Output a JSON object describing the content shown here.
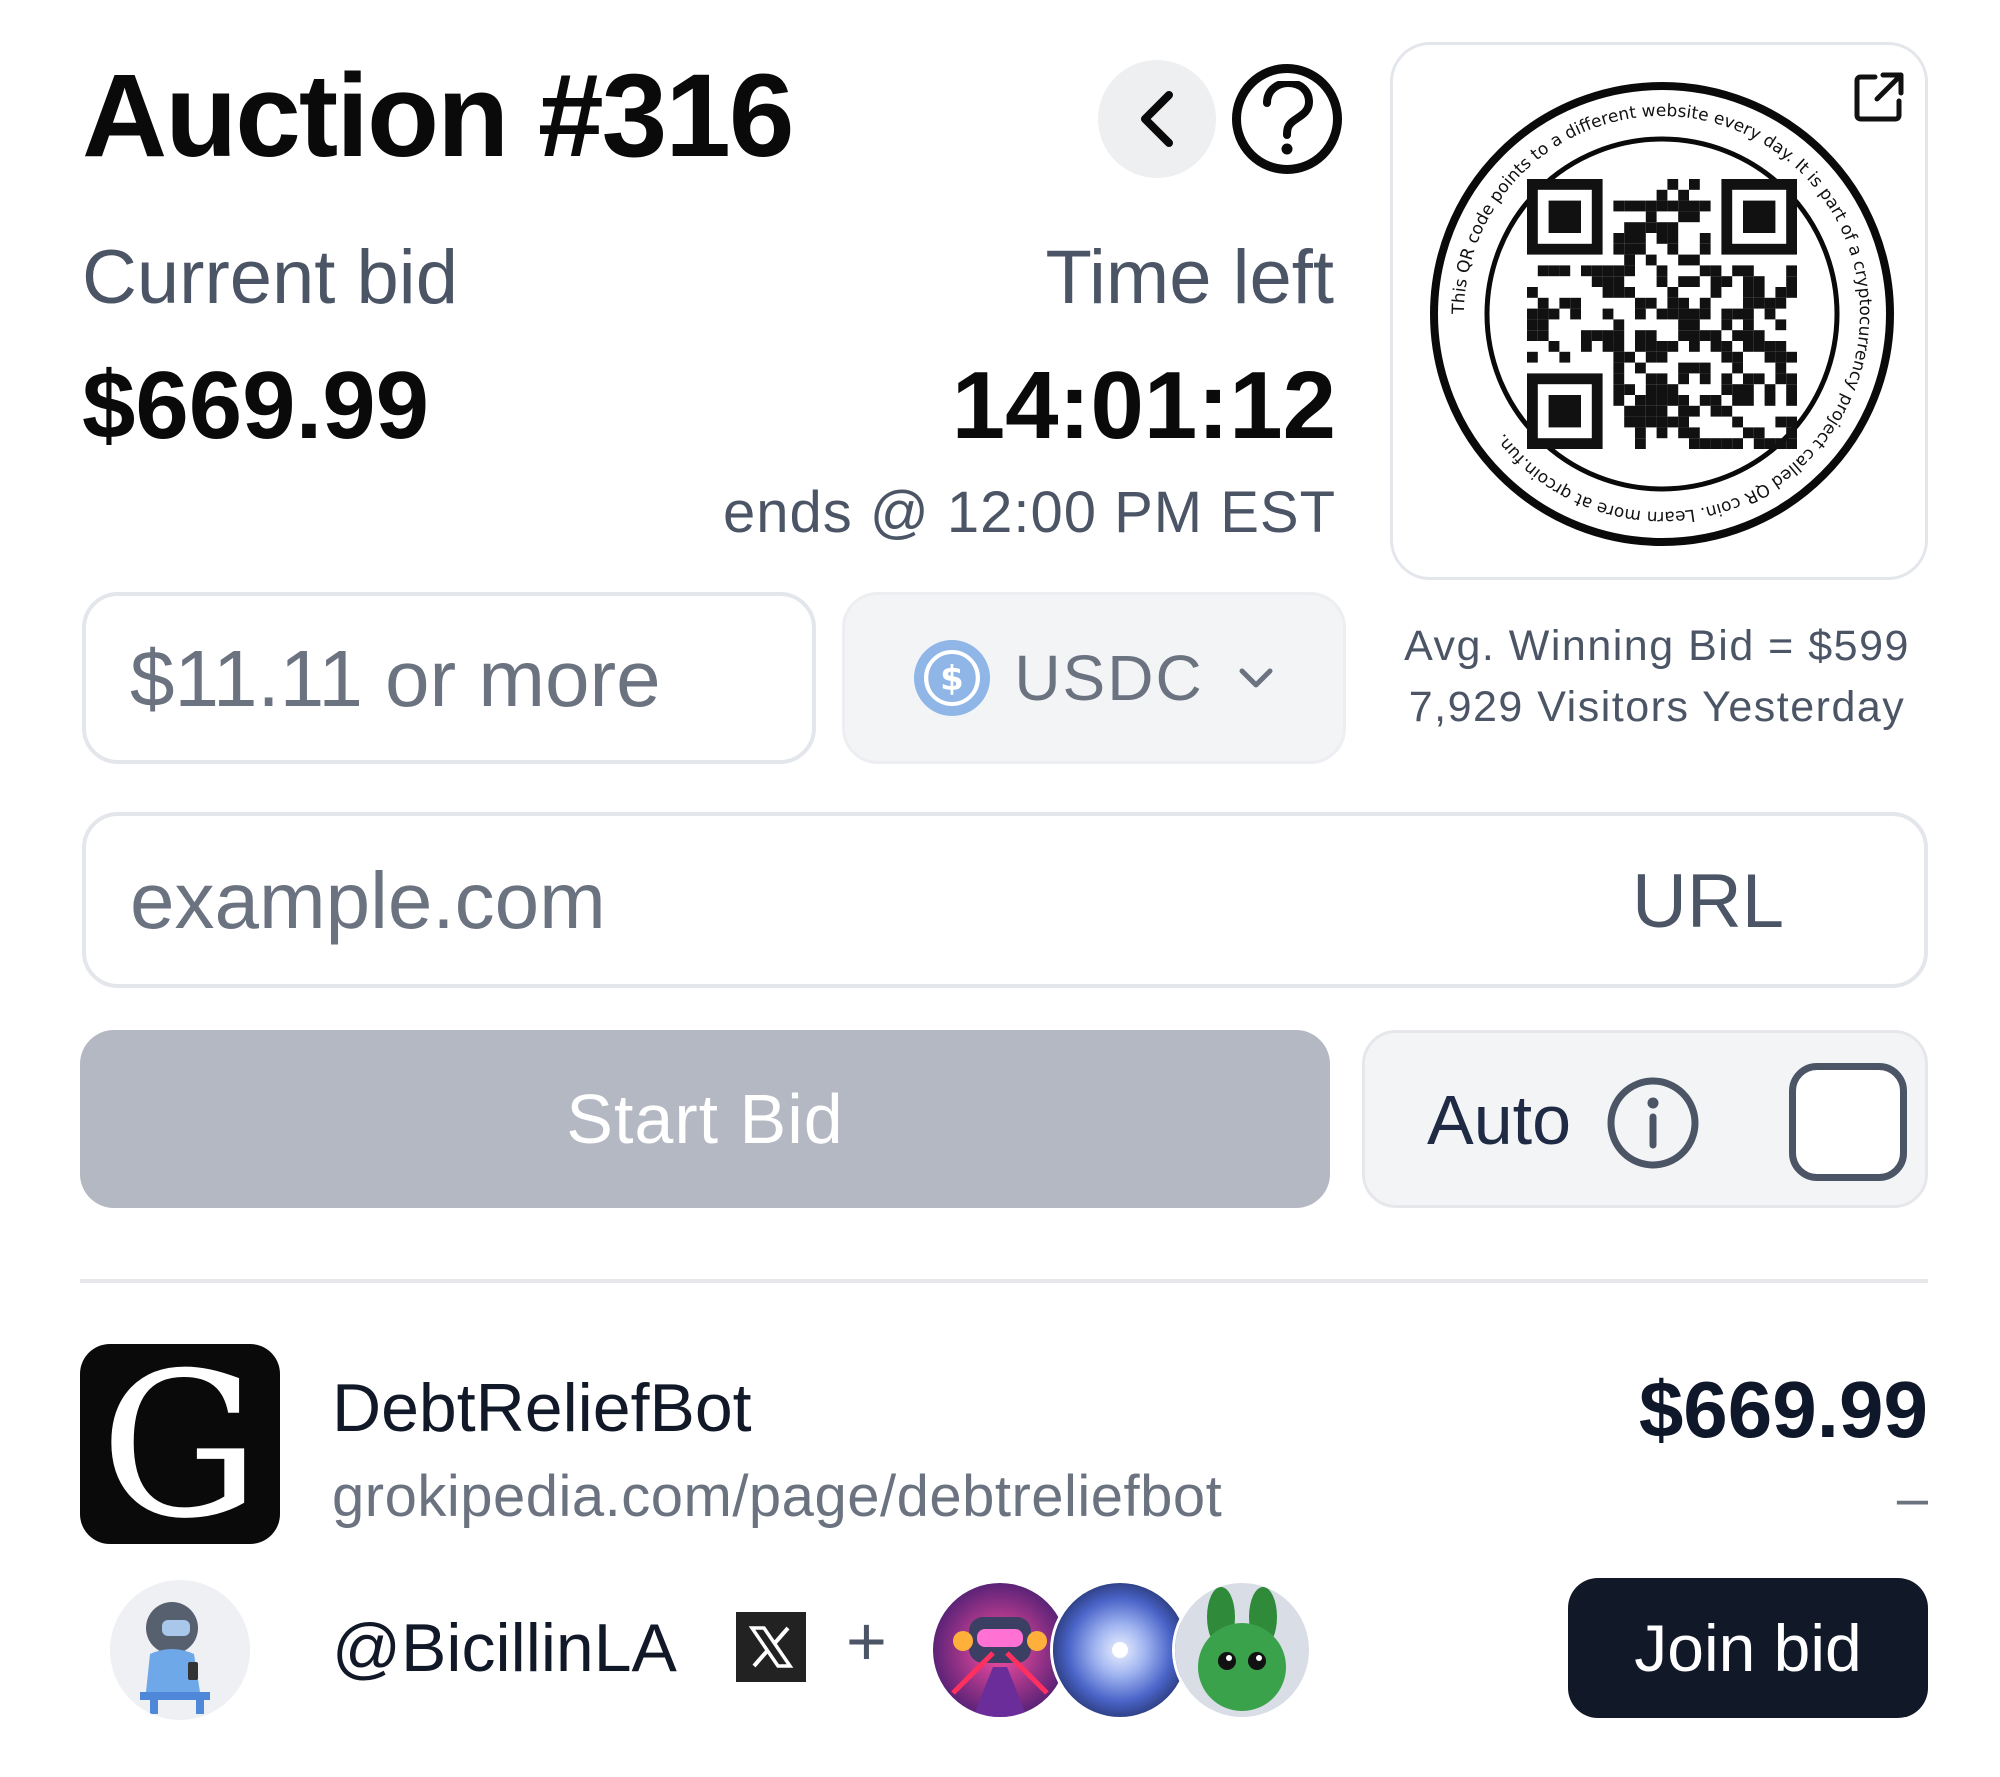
{
  "auction": {
    "title": "Auction #316"
  },
  "current_bid": {
    "label": "Current bid",
    "value": "$669.99"
  },
  "time_left": {
    "label": "Time left",
    "value": "14:01:12",
    "ends": "ends @ 12:00 PM EST"
  },
  "qr_card": {
    "ring_text": "This QR code points to a different website every day. It is part of a cryptocurrency project called QR coin. Learn more at qrcoin.fun.",
    "icons": {
      "external": "external-link-icon"
    }
  },
  "stats": {
    "avg_winning_bid": "Avg. Winning Bid = $599",
    "visitors": "7,929 Visitors Yesterday"
  },
  "bid_form": {
    "amount_placeholder": "$11.11 or more",
    "currency": "USDC",
    "url_placeholder": "example.com",
    "url_suffix": "URL",
    "start_bid": "Start Bid",
    "auto_label": "Auto"
  },
  "entry": {
    "logo_letter": "G",
    "name": "DebtReliefBot",
    "url": "grokipedia.com/page/debtreliefbot",
    "amount": "$669.99",
    "dash": "–",
    "bidder": "@BicillinLA",
    "plus": "+",
    "join_label": "Join bid"
  },
  "colors": {
    "primary_dark": "#111827",
    "disabled_button": "#b3b8c2",
    "usdc_blue": "#2775ca",
    "muted_text": "#4b5565"
  }
}
